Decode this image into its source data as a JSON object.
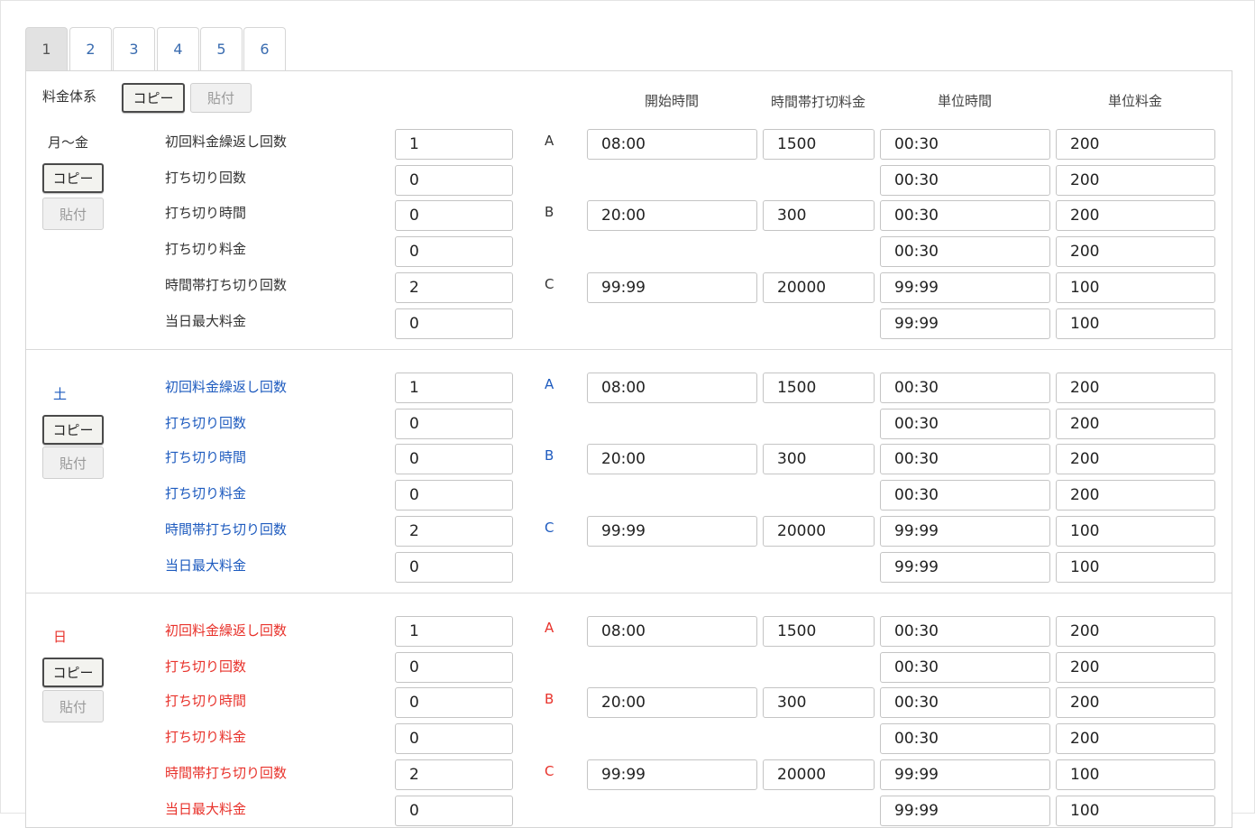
{
  "tabs": [
    "1",
    "2",
    "3",
    "4",
    "5",
    "6"
  ],
  "active_tab": "1",
  "header": {
    "fee_system_label": "料金体系",
    "copy_label": "コピー",
    "paste_label": "貼付",
    "col_start_time": "開始時間",
    "col_band_cap_fee": "時間帯打切料金",
    "col_unit_time": "単位時間",
    "col_unit_fee": "単位料金"
  },
  "colors": {
    "weekday": "#333333",
    "saturday": "#1e5bbf",
    "sunday": "#e8322b",
    "tab_active_bg": "#e2e2e2"
  },
  "sections": [
    {
      "day_label": "月～金",
      "copy_label": "コピー",
      "paste_label": "貼付",
      "rows": [
        {
          "label": "初回料金繰返し回数",
          "value": "1",
          "band": "A",
          "start_time": "08:00",
          "cap_fee": "1500",
          "unit_time": "00:30",
          "unit_fee": "200"
        },
        {
          "label": "打ち切り回数",
          "value": "0",
          "unit_time": "00:30",
          "unit_fee": "200"
        },
        {
          "label": "打ち切り時間",
          "value": "0",
          "band": "B",
          "start_time": "20:00",
          "cap_fee": "300",
          "unit_time": "00:30",
          "unit_fee": "200"
        },
        {
          "label": "打ち切り料金",
          "value": "0",
          "unit_time": "00:30",
          "unit_fee": "200"
        },
        {
          "label": "時間帯打ち切り回数",
          "value": "2",
          "band": "C",
          "start_time": "99:99",
          "cap_fee": "20000",
          "unit_time": "99:99",
          "unit_fee": "100"
        },
        {
          "label": "当日最大料金",
          "value": "0",
          "unit_time": "99:99",
          "unit_fee": "100"
        }
      ]
    },
    {
      "day_label": "土",
      "copy_label": "コピー",
      "paste_label": "貼付",
      "rows": [
        {
          "label": "初回料金繰返し回数",
          "value": "1",
          "band": "A",
          "start_time": "08:00",
          "cap_fee": "1500",
          "unit_time": "00:30",
          "unit_fee": "200"
        },
        {
          "label": "打ち切り回数",
          "value": "0",
          "unit_time": "00:30",
          "unit_fee": "200"
        },
        {
          "label": "打ち切り時間",
          "value": "0",
          "band": "B",
          "start_time": "20:00",
          "cap_fee": "300",
          "unit_time": "00:30",
          "unit_fee": "200"
        },
        {
          "label": "打ち切り料金",
          "value": "0",
          "unit_time": "00:30",
          "unit_fee": "200"
        },
        {
          "label": "時間帯打ち切り回数",
          "value": "2",
          "band": "C",
          "start_time": "99:99",
          "cap_fee": "20000",
          "unit_time": "99:99",
          "unit_fee": "100"
        },
        {
          "label": "当日最大料金",
          "value": "0",
          "unit_time": "99:99",
          "unit_fee": "100"
        }
      ]
    },
    {
      "day_label": "日",
      "copy_label": "コピー",
      "paste_label": "貼付",
      "rows": [
        {
          "label": "初回料金繰返し回数",
          "value": "1",
          "band": "A",
          "start_time": "08:00",
          "cap_fee": "1500",
          "unit_time": "00:30",
          "unit_fee": "200"
        },
        {
          "label": "打ち切り回数",
          "value": "0",
          "unit_time": "00:30",
          "unit_fee": "200"
        },
        {
          "label": "打ち切り時間",
          "value": "0",
          "band": "B",
          "start_time": "20:00",
          "cap_fee": "300",
          "unit_time": "00:30",
          "unit_fee": "200"
        },
        {
          "label": "打ち切り料金",
          "value": "0",
          "unit_time": "00:30",
          "unit_fee": "200"
        },
        {
          "label": "時間帯打ち切り回数",
          "value": "2",
          "band": "C",
          "start_time": "99:99",
          "cap_fee": "20000",
          "unit_time": "99:99",
          "unit_fee": "100"
        },
        {
          "label": "当日最大料金",
          "value": "0",
          "unit_time": "99:99",
          "unit_fee": "100"
        }
      ]
    }
  ]
}
